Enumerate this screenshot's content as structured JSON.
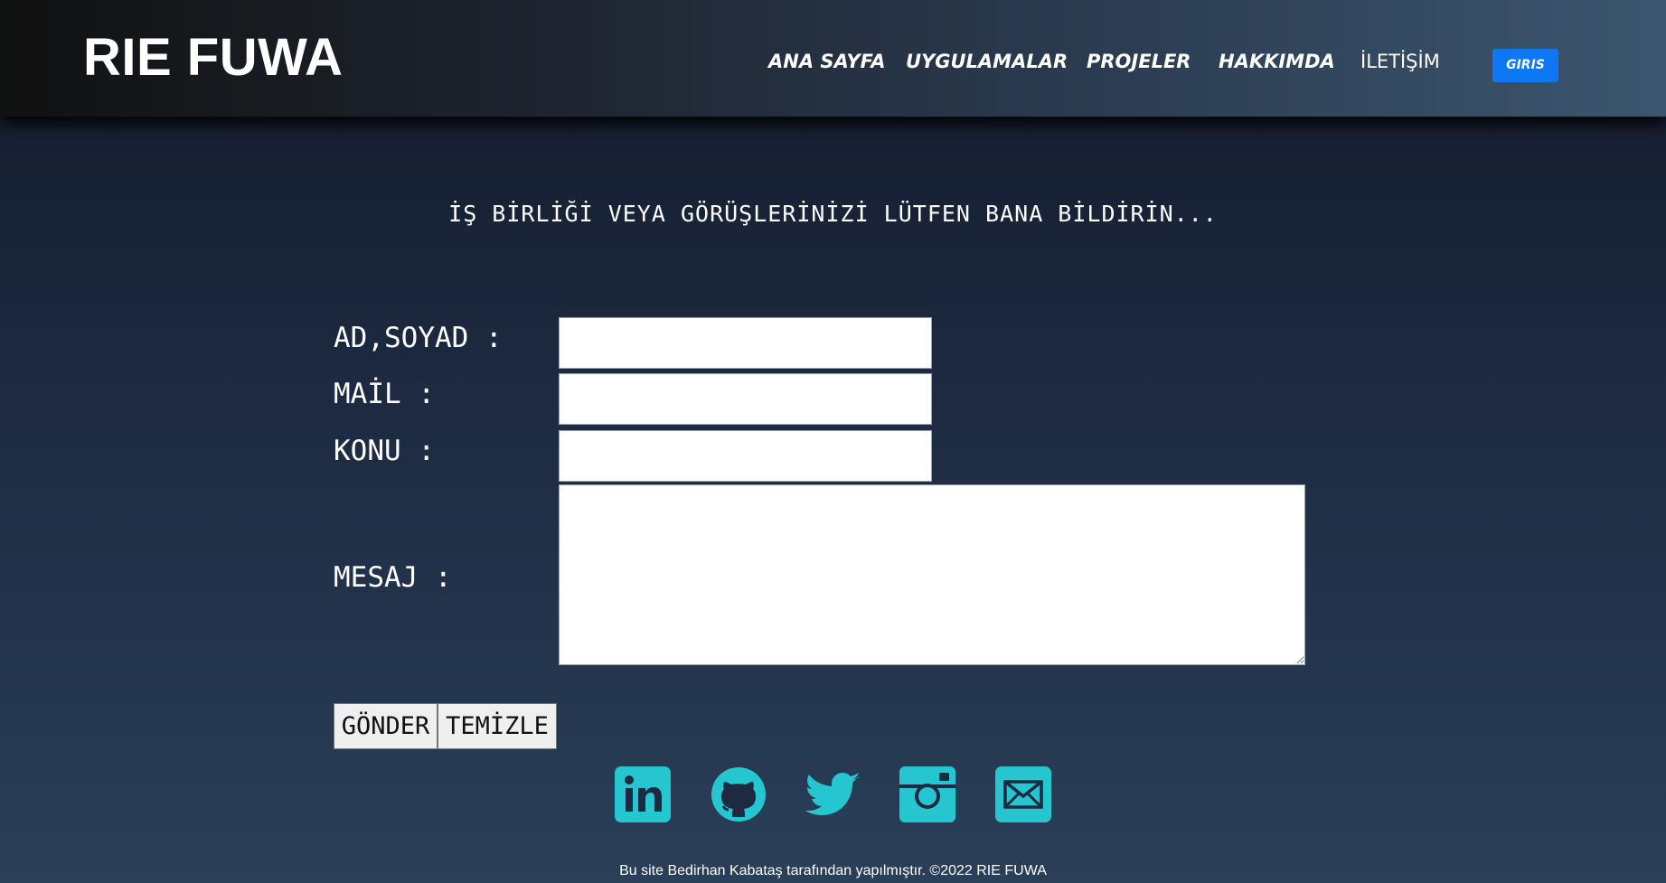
{
  "brand": {
    "logo": "RIE FUWA"
  },
  "nav": {
    "items": [
      {
        "label": "ANA SAYFA"
      },
      {
        "label": "UYGULAMALAR"
      },
      {
        "label": "PROJELER"
      },
      {
        "label": "HAKKIMDA"
      },
      {
        "label": "İLETİŞİM"
      }
    ],
    "login_label": "GIRIS",
    "login_color": "#0d78f2"
  },
  "contact": {
    "heading": "İŞ BİRLİĞİ VEYA GÖRÜŞLERİNİZİ LÜTFEN BANA BİLDİRİN...",
    "fields": {
      "name_label": "AD,SOYAD :",
      "name_value": "",
      "mail_label": "MAİL :",
      "mail_value": "",
      "subject_label": "KONU :",
      "subject_value": "",
      "message_label": "MESAJ :",
      "message_value": ""
    },
    "buttons": {
      "send": "GÖNDER",
      "clear": "TEMİZLE"
    }
  },
  "social": {
    "icon_color": "#26c6d0",
    "icons": [
      "linkedin-icon",
      "github-icon",
      "twitter-icon",
      "instagram-icon",
      "mail-icon"
    ]
  },
  "footer": {
    "text": "Bu site Bedirhan Kabataş tarafından yapılmıştır. ©2022 RIE FUWA"
  }
}
